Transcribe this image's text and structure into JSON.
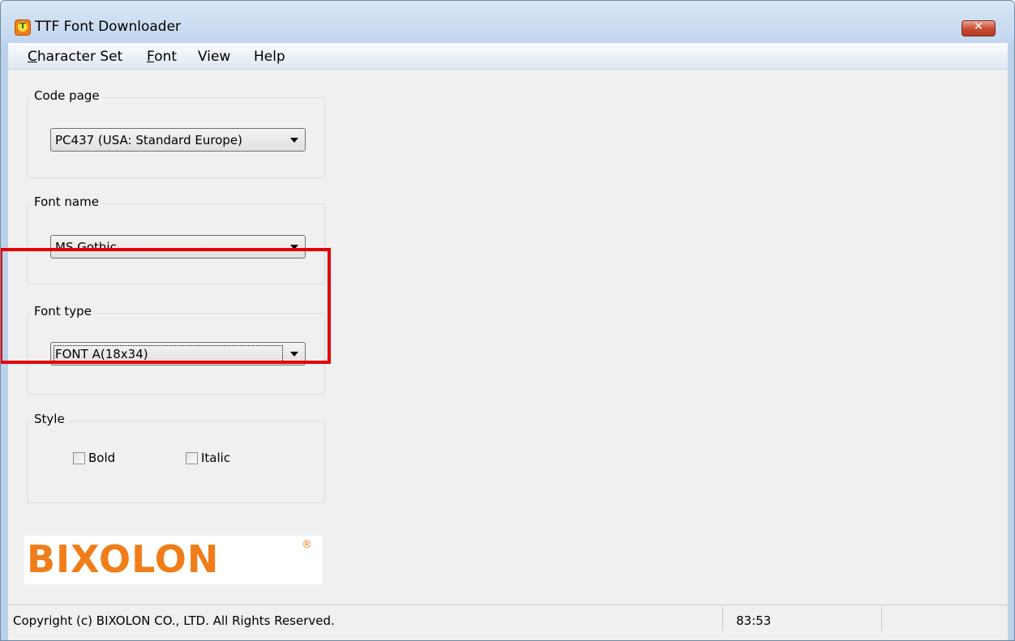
{
  "window": {
    "title": "TTF Font Downloader",
    "close_label": "✕"
  },
  "menubar": {
    "items": [
      {
        "label": "Character Set",
        "mnemonic": "C"
      },
      {
        "label": "Font",
        "mnemonic": "F"
      },
      {
        "label": "View"
      },
      {
        "label": "Help"
      }
    ]
  },
  "code_page": {
    "group_label": "Code page",
    "selected": "PC437 (USA: Standard Europe)"
  },
  "font_name": {
    "group_label": "Font name",
    "selected": "MS Gothic"
  },
  "font_type": {
    "group_label": "Font type",
    "selected": "FONT A(18x34)"
  },
  "style": {
    "group_label": "Style",
    "bold_label": "Bold",
    "bold_checked": false,
    "italic_label": "Italic",
    "italic_checked": false
  },
  "logo": {
    "text": "BIXOLON",
    "registered": "®"
  },
  "statusbar": {
    "copyright": "Copyright (c) BIXOLON CO., LTD. All Rights Reserved.",
    "position": "83:53"
  },
  "colors": {
    "highlight": "#e30000",
    "brand": "#f07d1a"
  }
}
